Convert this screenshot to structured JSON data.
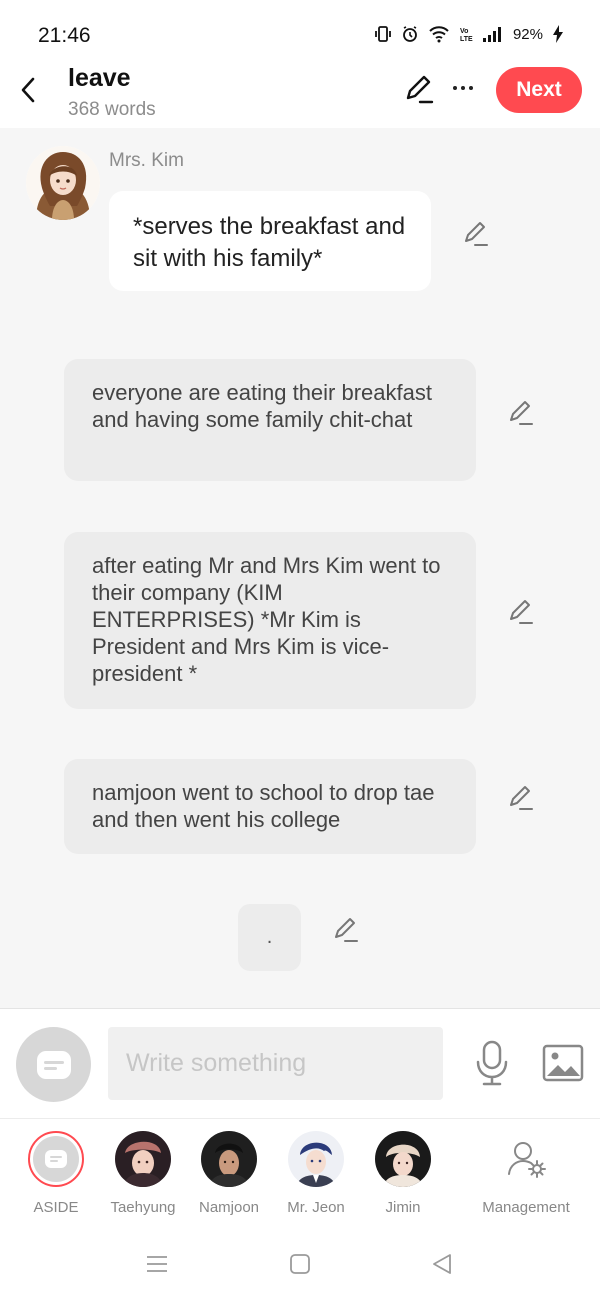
{
  "status": {
    "time": "21:46",
    "battery": "92%"
  },
  "header": {
    "title": "leave",
    "subtitle": "368 words",
    "next_label": "Next"
  },
  "chat": {
    "character_name": "Mrs. Kim",
    "character_message": "*serves the breakfast and sit with his family*",
    "narrations": [
      "everyone are eating their breakfast and having some family chit-chat",
      "after eating Mr and Mrs Kim went to their company (KIM ENTERPRISES) *Mr Kim is President and Mrs Kim is vice-president *",
      "namjoon went to school to drop tae and then went his college"
    ],
    "last_bubble": "."
  },
  "composer": {
    "placeholder": "Write something"
  },
  "characters": [
    {
      "label": "ASIDE"
    },
    {
      "label": "Taehyung"
    },
    {
      "label": "Namjoon"
    },
    {
      "label": "Mr. Jeon"
    },
    {
      "label": "Jimin"
    },
    {
      "label": "Management"
    }
  ],
  "colors": {
    "accent": "#ff4a50",
    "background": "#f6f6f6",
    "bubble_grey": "#ececec"
  }
}
